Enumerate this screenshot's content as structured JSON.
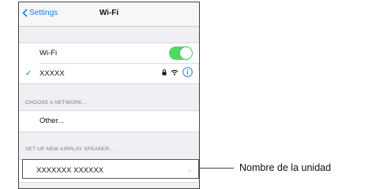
{
  "nav": {
    "back_label": "Settings",
    "title": "Wi-Fi"
  },
  "wifi_row": {
    "label": "Wi-Fi",
    "toggle_on": true
  },
  "connected_network": {
    "check_glyph": "✓",
    "name": "XXXXX",
    "icons": [
      "lock-icon",
      "wifi-signal-icon",
      "info-icon"
    ]
  },
  "choose_network": {
    "header": "CHOOSE A NETWORK...",
    "other_label": "Other..."
  },
  "airplay": {
    "header": "SET UP NEW AIRPLAY SPEAKER...",
    "speaker_name": "XXXXXXX XXXXXX",
    "chevron": "›"
  },
  "callout": {
    "label": "Nombre de la unidad"
  },
  "colors": {
    "accent": "#1a7cf0",
    "toggle_on": "#4cd964",
    "background": "#efeff4"
  }
}
